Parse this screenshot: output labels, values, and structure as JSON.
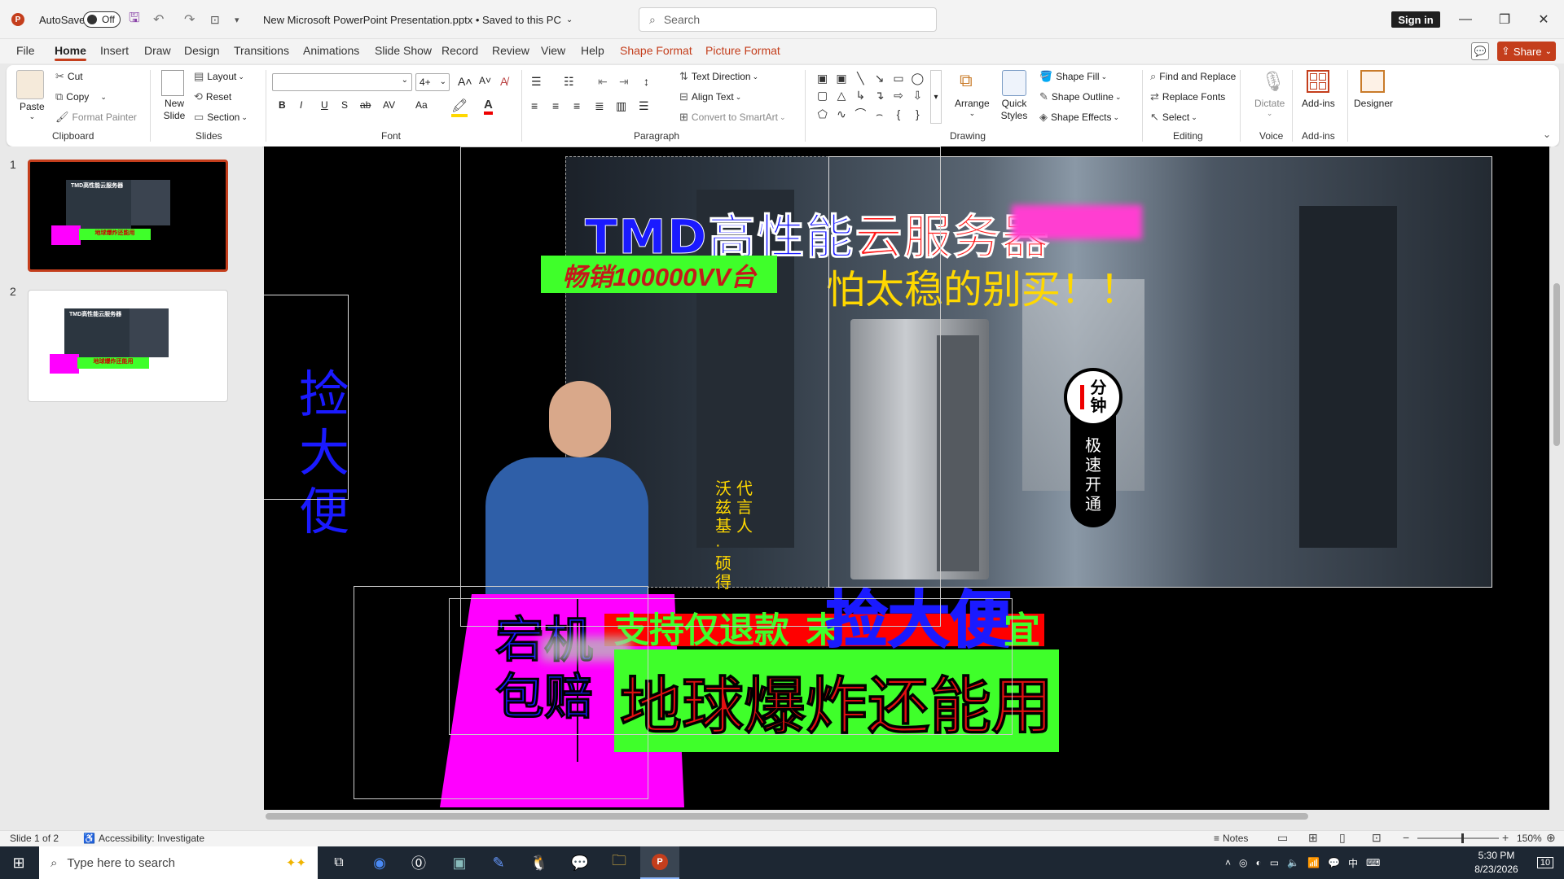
{
  "titlebar": {
    "app_icon": "powerpoint-icon",
    "autosave_label": "AutoSave",
    "autosave_state": "Off",
    "file_title": "New Microsoft PowerPoint Presentation.pptx • Saved to this PC",
    "search_placeholder": "Search",
    "signin_label": "Sign in"
  },
  "tabs": [
    "File",
    "Home",
    "Insert",
    "Draw",
    "Design",
    "Transitions",
    "Animations",
    "Slide Show",
    "Record",
    "Review",
    "View",
    "Help",
    "Shape Format",
    "Picture Format"
  ],
  "tabs_active": "Home",
  "top_right": {
    "share_label": "Share"
  },
  "ribbon": {
    "clipboard": {
      "paste": "Paste",
      "cut": "Cut",
      "copy": "Copy",
      "format_painter": "Format Painter",
      "group": "Clipboard"
    },
    "slides": {
      "new_slide": "New Slide",
      "layout": "Layout",
      "reset": "Reset",
      "section": "Section",
      "group": "Slides"
    },
    "font": {
      "font_name": "",
      "font_size": "4+",
      "group": "Font",
      "bold": "B",
      "italic": "I",
      "underline": "U",
      "shadow": "S",
      "strike": "ab",
      "spacing": "AV",
      "case": "Aa"
    },
    "paragraph": {
      "text_direction": "Text Direction",
      "align_text": "Align Text",
      "convert_smartart": "Convert to SmartArt",
      "group": "Paragraph"
    },
    "drawing": {
      "arrange": "Arrange",
      "quick_styles": "Quick Styles",
      "shape_fill": "Shape Fill",
      "shape_outline": "Shape Outline",
      "shape_effects": "Shape Effects",
      "group": "Drawing"
    },
    "editing": {
      "find_replace": "Find and Replace",
      "replace_fonts": "Replace Fonts",
      "select": "Select",
      "group": "Editing"
    },
    "voice": {
      "dictate": "Dictate",
      "group": "Voice"
    },
    "addins": {
      "addins": "Add-ins",
      "group": "Add-ins"
    },
    "designer": {
      "designer": "Designer"
    }
  },
  "thumbnails": [
    {
      "num": "1",
      "mini": "TMD高性能云服务器",
      "mini2": "地球爆炸还能用"
    },
    {
      "num": "2",
      "mini": "TMD高性能云服务器",
      "mini2": "地球爆炸还能用"
    }
  ],
  "slide": {
    "title_blue": "TMD高性",
    "title_blue2": "能",
    "title_red": "云服务器",
    "sales_banner": "畅销100000VV台",
    "yellow_slogan": "怕太稳的别买！！",
    "left_vertical": [
      "捡",
      "大",
      "便"
    ],
    "spokes_col1": [
      "沃",
      "兹",
      "基",
      "·",
      "硕",
      "得"
    ],
    "spokes_col2": [
      "代",
      "言",
      "人"
    ],
    "badge_top": [
      "分",
      "钟"
    ],
    "badge_bottom": [
      "极",
      "速",
      "开",
      "通"
    ],
    "red_strip": "支持仅退款",
    "red_strip2": "末",
    "big_blue": "捡大便",
    "red_strip_end": "宜",
    "magenta_line1": "宕机",
    "magenta_line2": "包赔",
    "green_big": "地球爆炸还能用"
  },
  "status": {
    "slide_of": "Slide 1 of 2",
    "accessibility": "Accessibility: Investigate",
    "notes": "Notes",
    "zoom": "150%"
  },
  "taskbar": {
    "search_placeholder": "Type here to search",
    "time": "5:30 PM",
    "date": "8/23/2026",
    "lang": "中",
    "notif": "10"
  },
  "colors": {
    "accent": "#c43e1c",
    "slide_bg": "#000000",
    "magenta": "#ff00ff",
    "green": "#3fff2a",
    "red": "#ff0000",
    "blue": "#1a1aff",
    "yellow": "#ffd800"
  }
}
